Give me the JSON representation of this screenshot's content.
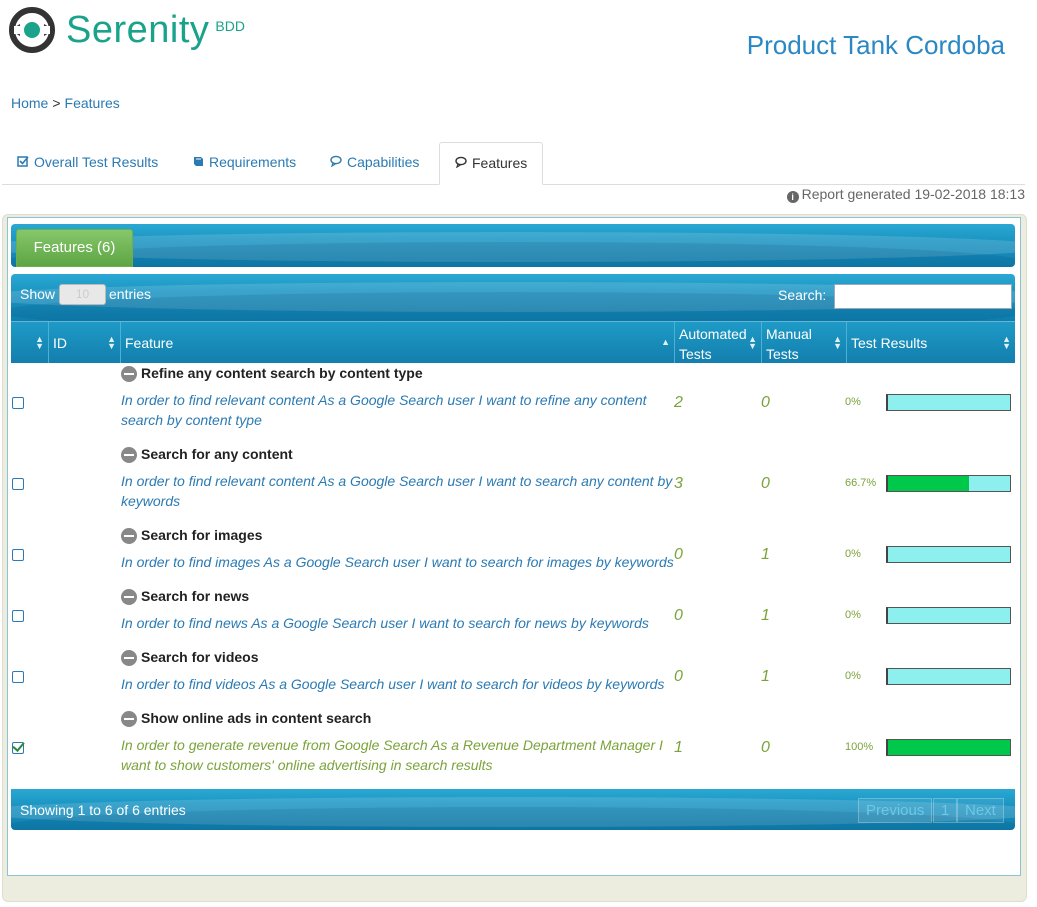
{
  "brand": {
    "name_prefix": "Se",
    "name_rest": "renity",
    "sub": "BDD"
  },
  "project_title": "Product Tank Cordoba",
  "breadcrumb": {
    "home": "Home",
    "separator": ">",
    "current": "Features"
  },
  "tabs": [
    {
      "label": "Overall Test Results",
      "icon": "check-square-icon"
    },
    {
      "label": "Requirements",
      "icon": "book-icon"
    },
    {
      "label": "Capabilities",
      "icon": "comments-icon"
    },
    {
      "label": "Features",
      "icon": "comments-icon"
    }
  ],
  "report_generated": "Report generated 19-02-2018 18:13",
  "features_tab_label": "Features (6)",
  "table_controls": {
    "show_label": "Show",
    "entries_label": "entries",
    "entries_value": "10",
    "search_label": "Search:",
    "search_value": ""
  },
  "columns": [
    {
      "label": ""
    },
    {
      "label": "ID"
    },
    {
      "label": "Feature"
    },
    {
      "label": "Automated Tests"
    },
    {
      "label": "Manual Tests"
    },
    {
      "label": "Test Results"
    }
  ],
  "rows": [
    {
      "title": "Refine any content search by content type",
      "description": "In order to find relevant content As a Google Search user I want to refine any content search by content type",
      "automated": "2",
      "manual": "0",
      "percent": "0%",
      "pass_fraction": 0,
      "checked": false
    },
    {
      "title": "Search for any content",
      "description": "In order to find relevant content As a Google Search user I want to search any content by keywords",
      "automated": "3",
      "manual": "0",
      "percent": "66.7%",
      "pass_fraction": 0.667,
      "checked": false
    },
    {
      "title": "Search for images",
      "description": "In order to find images As a Google Search user I want to search for images by keywords",
      "automated": "0",
      "manual": "1",
      "percent": "0%",
      "pass_fraction": 0,
      "checked": false
    },
    {
      "title": "Search for news",
      "description": "In order to find news As a Google Search user I want to search for news by keywords",
      "automated": "0",
      "manual": "1",
      "percent": "0%",
      "pass_fraction": 0,
      "checked": false
    },
    {
      "title": "Search for videos",
      "description": "In order to find videos As a Google Search user I want to search for videos by keywords",
      "automated": "0",
      "manual": "1",
      "percent": "0%",
      "pass_fraction": 0,
      "checked": false
    },
    {
      "title": "Show online ads in content search",
      "description": "In order to generate revenue from Google Search As a Revenue Department Manager I want to show customers' online advertising in search results",
      "automated": "1",
      "manual": "0",
      "percent": "100%",
      "pass_fraction": 1,
      "checked": true
    }
  ],
  "footer": {
    "showing": "Showing 1 to 6 of 6 entries",
    "previous": "Previous",
    "page": "1",
    "next": "Next"
  },
  "colors": {
    "accent": "#1aa38a",
    "link": "#2a7ab3",
    "pass": "#00c84a",
    "pending": "#8ef0ee"
  }
}
